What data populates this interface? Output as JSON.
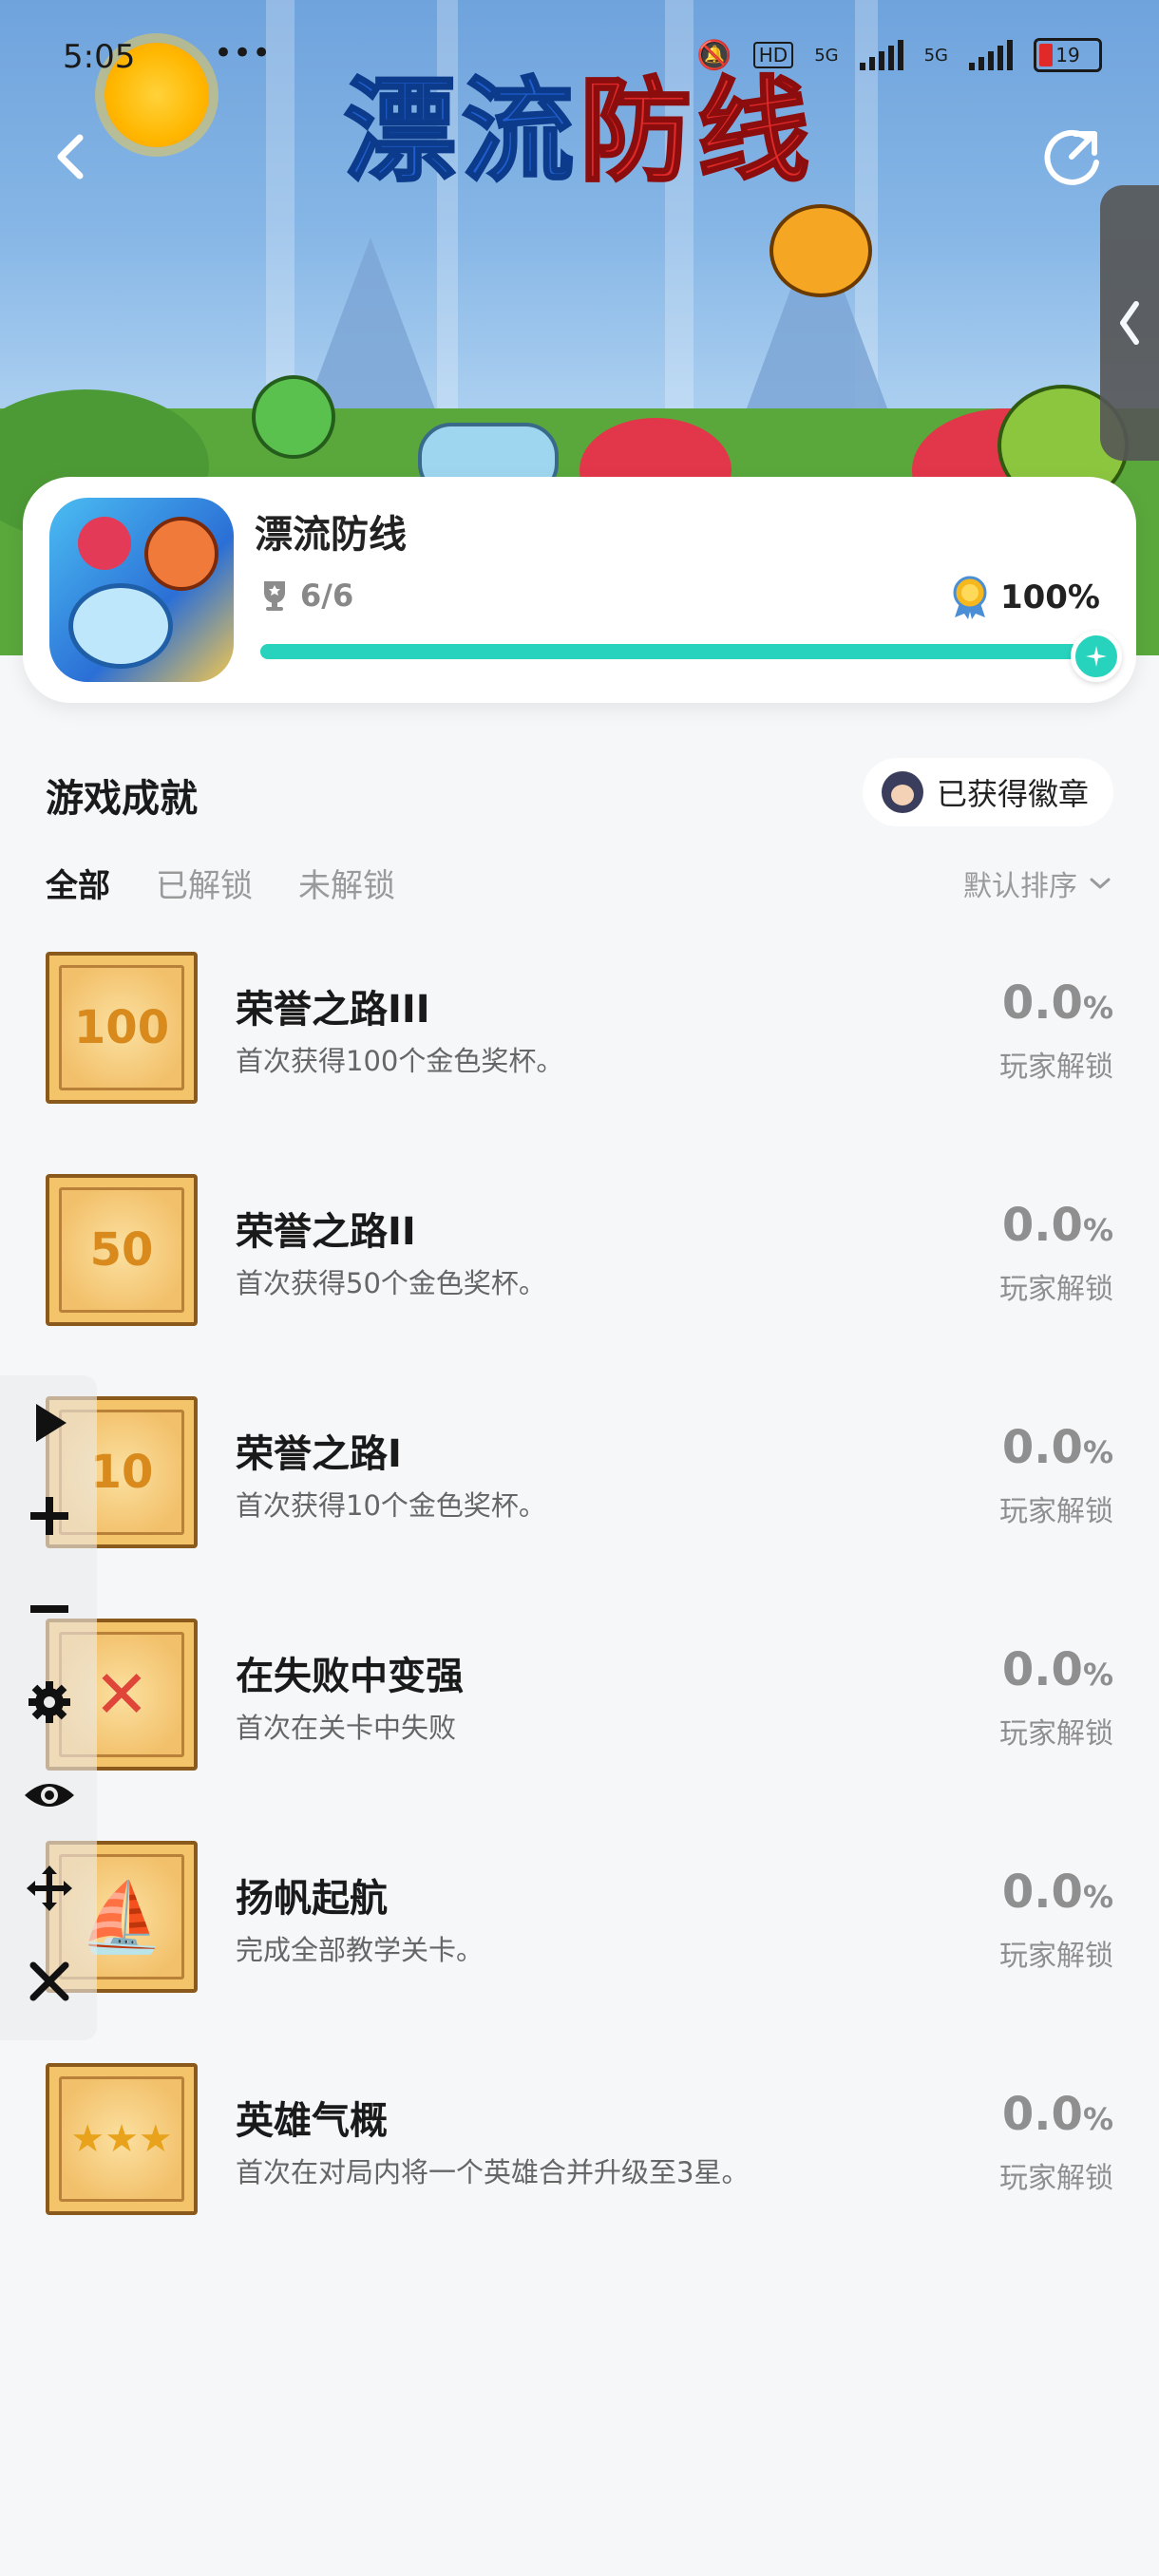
{
  "status_bar": {
    "time": "5:05",
    "dots": "•••",
    "network1": "5G",
    "network2": "5G",
    "battery": "19"
  },
  "header": {
    "banner_title_part1": "漂流",
    "banner_title_part2": "防线"
  },
  "game": {
    "name": "漂流防线",
    "trophies": "6/6",
    "completion": "100%",
    "progress_fraction": 1.0
  },
  "section": {
    "title": "游戏成就",
    "badge_button": "已获得徽章",
    "tabs": [
      "全部",
      "已解锁",
      "未解锁"
    ],
    "sort_label": "默认排序"
  },
  "achievements": [
    {
      "title": "荣誉之路III",
      "desc": "首次获得100个金色奖杯。",
      "pct": "0.0",
      "pct_unit": "%",
      "sub": "玩家解锁",
      "glyph": "100"
    },
    {
      "title": "荣誉之路II",
      "desc": "首次获得50个金色奖杯。",
      "pct": "0.0",
      "pct_unit": "%",
      "sub": "玩家解锁",
      "glyph": "50"
    },
    {
      "title": "荣誉之路I",
      "desc": "首次获得10个金色奖杯。",
      "pct": "0.0",
      "pct_unit": "%",
      "sub": "玩家解锁",
      "glyph": "10"
    },
    {
      "title": "在失败中变强",
      "desc": "首次在关卡中失败",
      "pct": "0.0",
      "pct_unit": "%",
      "sub": "玩家解锁",
      "glyph": "✕"
    },
    {
      "title": "扬帆起航",
      "desc": "完成全部教学关卡。",
      "pct": "0.0",
      "pct_unit": "%",
      "sub": "玩家解锁",
      "glyph": "⛵"
    },
    {
      "title": "英雄气概",
      "desc": "首次在对局内将一个英雄合并升级至3星。",
      "pct": "0.0",
      "pct_unit": "%",
      "sub": "玩家解锁",
      "glyph": "★★★"
    }
  ],
  "tools": [
    "play-icon",
    "plus-icon",
    "minus-icon",
    "gear-icon",
    "eye-icon",
    "move-icon",
    "close-icon"
  ],
  "colors": {
    "accent": "#27d3bd",
    "title_blue": "#1f5fd0",
    "title_red": "#e02a2a",
    "badge_gold": "#f4c46a"
  }
}
